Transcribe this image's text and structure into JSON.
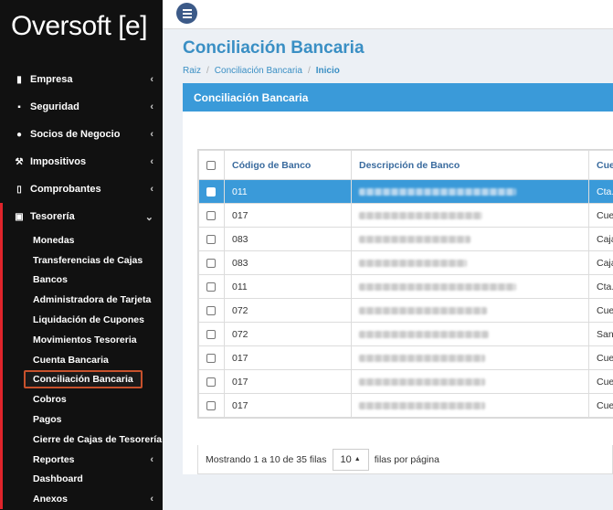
{
  "brand": {
    "name": "Oversoft",
    "mark": "[e]"
  },
  "sidebar": {
    "items": [
      {
        "label": "Empresa",
        "icon": "building-icon",
        "glyph": "▮"
      },
      {
        "label": "Seguridad",
        "icon": "lock-icon",
        "glyph": "🔒"
      },
      {
        "label": "Socios de Negocio",
        "icon": "user-icon",
        "glyph": "●"
      },
      {
        "label": "Impositivos",
        "icon": "gavel-icon",
        "glyph": "⚒"
      },
      {
        "label": "Comprobantes",
        "icon": "file-icon",
        "glyph": "▯"
      }
    ],
    "active": {
      "label": "Tesorería",
      "icon": "money-icon",
      "glyph": "▣"
    },
    "subitems": [
      "Monedas",
      "Transferencias de Cajas",
      "Bancos",
      "Administradora de Tarjeta",
      "Liquidación de Cupones",
      "Movimientos Tesoreria",
      "Cuenta Bancaria",
      "Conciliación Bancaria",
      "Cobros",
      "Pagos",
      "Cierre de Cajas de Tesorería",
      "Reportes",
      "Dashboard",
      "Anexos"
    ]
  },
  "main": {
    "title": "Conciliación Bancaria",
    "breadcrumb": [
      "Raiz",
      "Conciliación Bancaria",
      "Inicio"
    ],
    "panel_title": "Conciliación Bancaria"
  },
  "table": {
    "headers": [
      "Código de Banco",
      "Descripción de Banco",
      "Cue"
    ],
    "rows": [
      {
        "code": "011",
        "desc_width": 172,
        "type": "Cta."
      },
      {
        "code": "017",
        "desc_width": 135,
        "type": "Cuer"
      },
      {
        "code": "083",
        "desc_width": 122,
        "type": "Caja"
      },
      {
        "code": "083",
        "desc_width": 118,
        "type": "Caja"
      },
      {
        "code": "011",
        "desc_width": 172,
        "type": "Cta."
      },
      {
        "code": "072",
        "desc_width": 140,
        "type": "Cuer"
      },
      {
        "code": "072",
        "desc_width": 142,
        "type": "Sant"
      },
      {
        "code": "017",
        "desc_width": 138,
        "type": "Cuer"
      },
      {
        "code": "017",
        "desc_width": 138,
        "type": "Cuer"
      },
      {
        "code": "017",
        "desc_width": 138,
        "type": "Cuer"
      }
    ]
  },
  "footer": {
    "showing": "Mostrando 1 a 10 de 35 filas",
    "page_size": "10",
    "per_page": "filas por página"
  },
  "colors": {
    "accent": "#3a9ad9",
    "sidebar_bg": "#111111",
    "active_border": "#e0242b",
    "highlight": "#c7512c"
  }
}
